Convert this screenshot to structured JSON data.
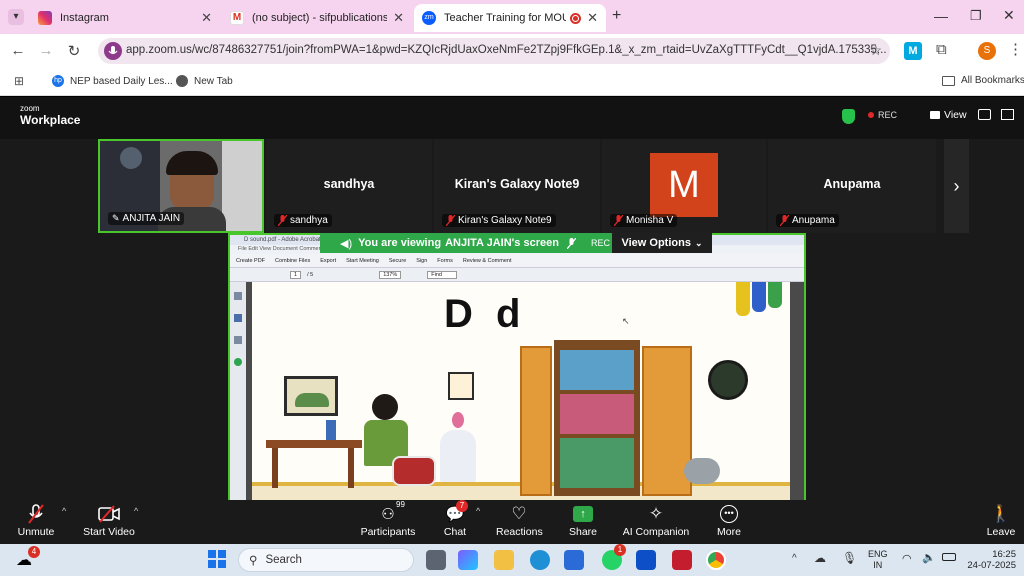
{
  "browser": {
    "tabs": [
      {
        "title": "Instagram",
        "icon": "instagram-icon"
      },
      {
        "title": "(no subject) - sifpublications@g",
        "icon": "gmail-icon"
      },
      {
        "title": "Teacher Training for MOU C",
        "icon": "zoom-icon",
        "active": true
      }
    ],
    "new_tab": "+",
    "url": "app.zoom.us/wc/87486327751/join?fromPWA=1&pwd=KZQIcRjdUaxOxeNmFe2TZpj9FfkGEp.1&_x_zm_rtaid=UvZaXgTTTFyCdt__Q1vjdA.175335...",
    "profile_initial": "S",
    "bookmarks": [
      {
        "label": "NEP based Daily Les..."
      },
      {
        "label": "New Tab"
      }
    ],
    "all_bookmarks": "All Bookmarks"
  },
  "zoom": {
    "logo_top": "zoom",
    "logo_bottom": "Workplace",
    "rec": "REC",
    "view": "View",
    "participants": [
      {
        "name": "ANJITA JAIN",
        "video": true
      },
      {
        "name": "sandhya",
        "big": "sandhya",
        "muted": true
      },
      {
        "name": "Kiran's Galaxy Note9",
        "big": "Kiran's Galaxy Note9",
        "muted": true
      },
      {
        "name": "Monisha V",
        "avatar": "M",
        "muted": true
      },
      {
        "name": "Anupama",
        "big": "Anupama",
        "muted": true
      }
    ],
    "banner": {
      "prefix": "You are viewing",
      "name": "ANJITA JAIN's screen",
      "rec": "REC"
    },
    "view_options": "View Options",
    "shared": {
      "window_title": "D sound.pdf - Adobe Acrobat Pro",
      "menus": "File  Edit  View  Document  Comments  Forms  Tools  Advanced  Window  Help",
      "toolbar": [
        "Create PDF",
        "Combine Files",
        "Export",
        "Start Meeting",
        "Secure",
        "Sign",
        "Forms",
        "Review & Comment"
      ],
      "page_current": "1",
      "page_total": "/ 5",
      "zoom": "137%",
      "find": "Find",
      "heading": "D d"
    },
    "controls": {
      "unmute": "Unmute",
      "start_video": "Start Video",
      "participants": "Participants",
      "participants_count": "99",
      "chat": "Chat",
      "chat_badge": "7",
      "reactions": "Reactions",
      "share": "Share",
      "ai": "AI Companion",
      "more": "More",
      "leave": "Leave"
    }
  },
  "taskbar": {
    "weather_badge": "4",
    "search": "Search",
    "badge_whatsapp": "1",
    "lang_top": "ENG",
    "lang_bottom": "IN",
    "time": "16:25",
    "date": "24-07-2025"
  },
  "colors": {
    "zoom_green": "#49c62b",
    "tab_bar": "#f6d4ef",
    "zoom_bg": "#1a1a1a",
    "monisha_avatar": "#d3431b"
  }
}
